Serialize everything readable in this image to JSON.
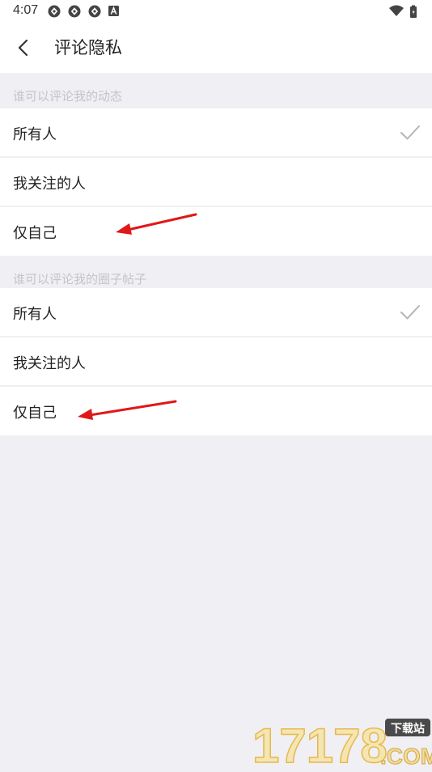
{
  "status_bar": {
    "time": "4:07",
    "icons": [
      "sync-icon",
      "sync-icon",
      "sync-icon",
      "a-letter-icon",
      "wifi-icon",
      "battery-icon"
    ]
  },
  "header": {
    "title": "评论隐私",
    "back_icon": "chevron-left-icon"
  },
  "sections": [
    {
      "title": "谁可以评论我的动态",
      "options": [
        {
          "label": "所有人",
          "selected": true
        },
        {
          "label": "我关注的人",
          "selected": false
        },
        {
          "label": "仅自己",
          "selected": false
        }
      ]
    },
    {
      "title": "谁可以评论我的圈子帖子",
      "options": [
        {
          "label": "所有人",
          "selected": true
        },
        {
          "label": "我关注的人",
          "selected": false
        },
        {
          "label": "仅自己",
          "selected": false
        }
      ]
    }
  ],
  "annotations": {
    "arrow_color": "#e01818"
  },
  "watermark": {
    "brand": "17178",
    "badge": "下载站",
    "suffix": ".COM"
  },
  "colors": {
    "background": "#efeff4",
    "surface": "#ffffff",
    "section_text": "#c4c4c9",
    "check": "#b5b5b8"
  }
}
